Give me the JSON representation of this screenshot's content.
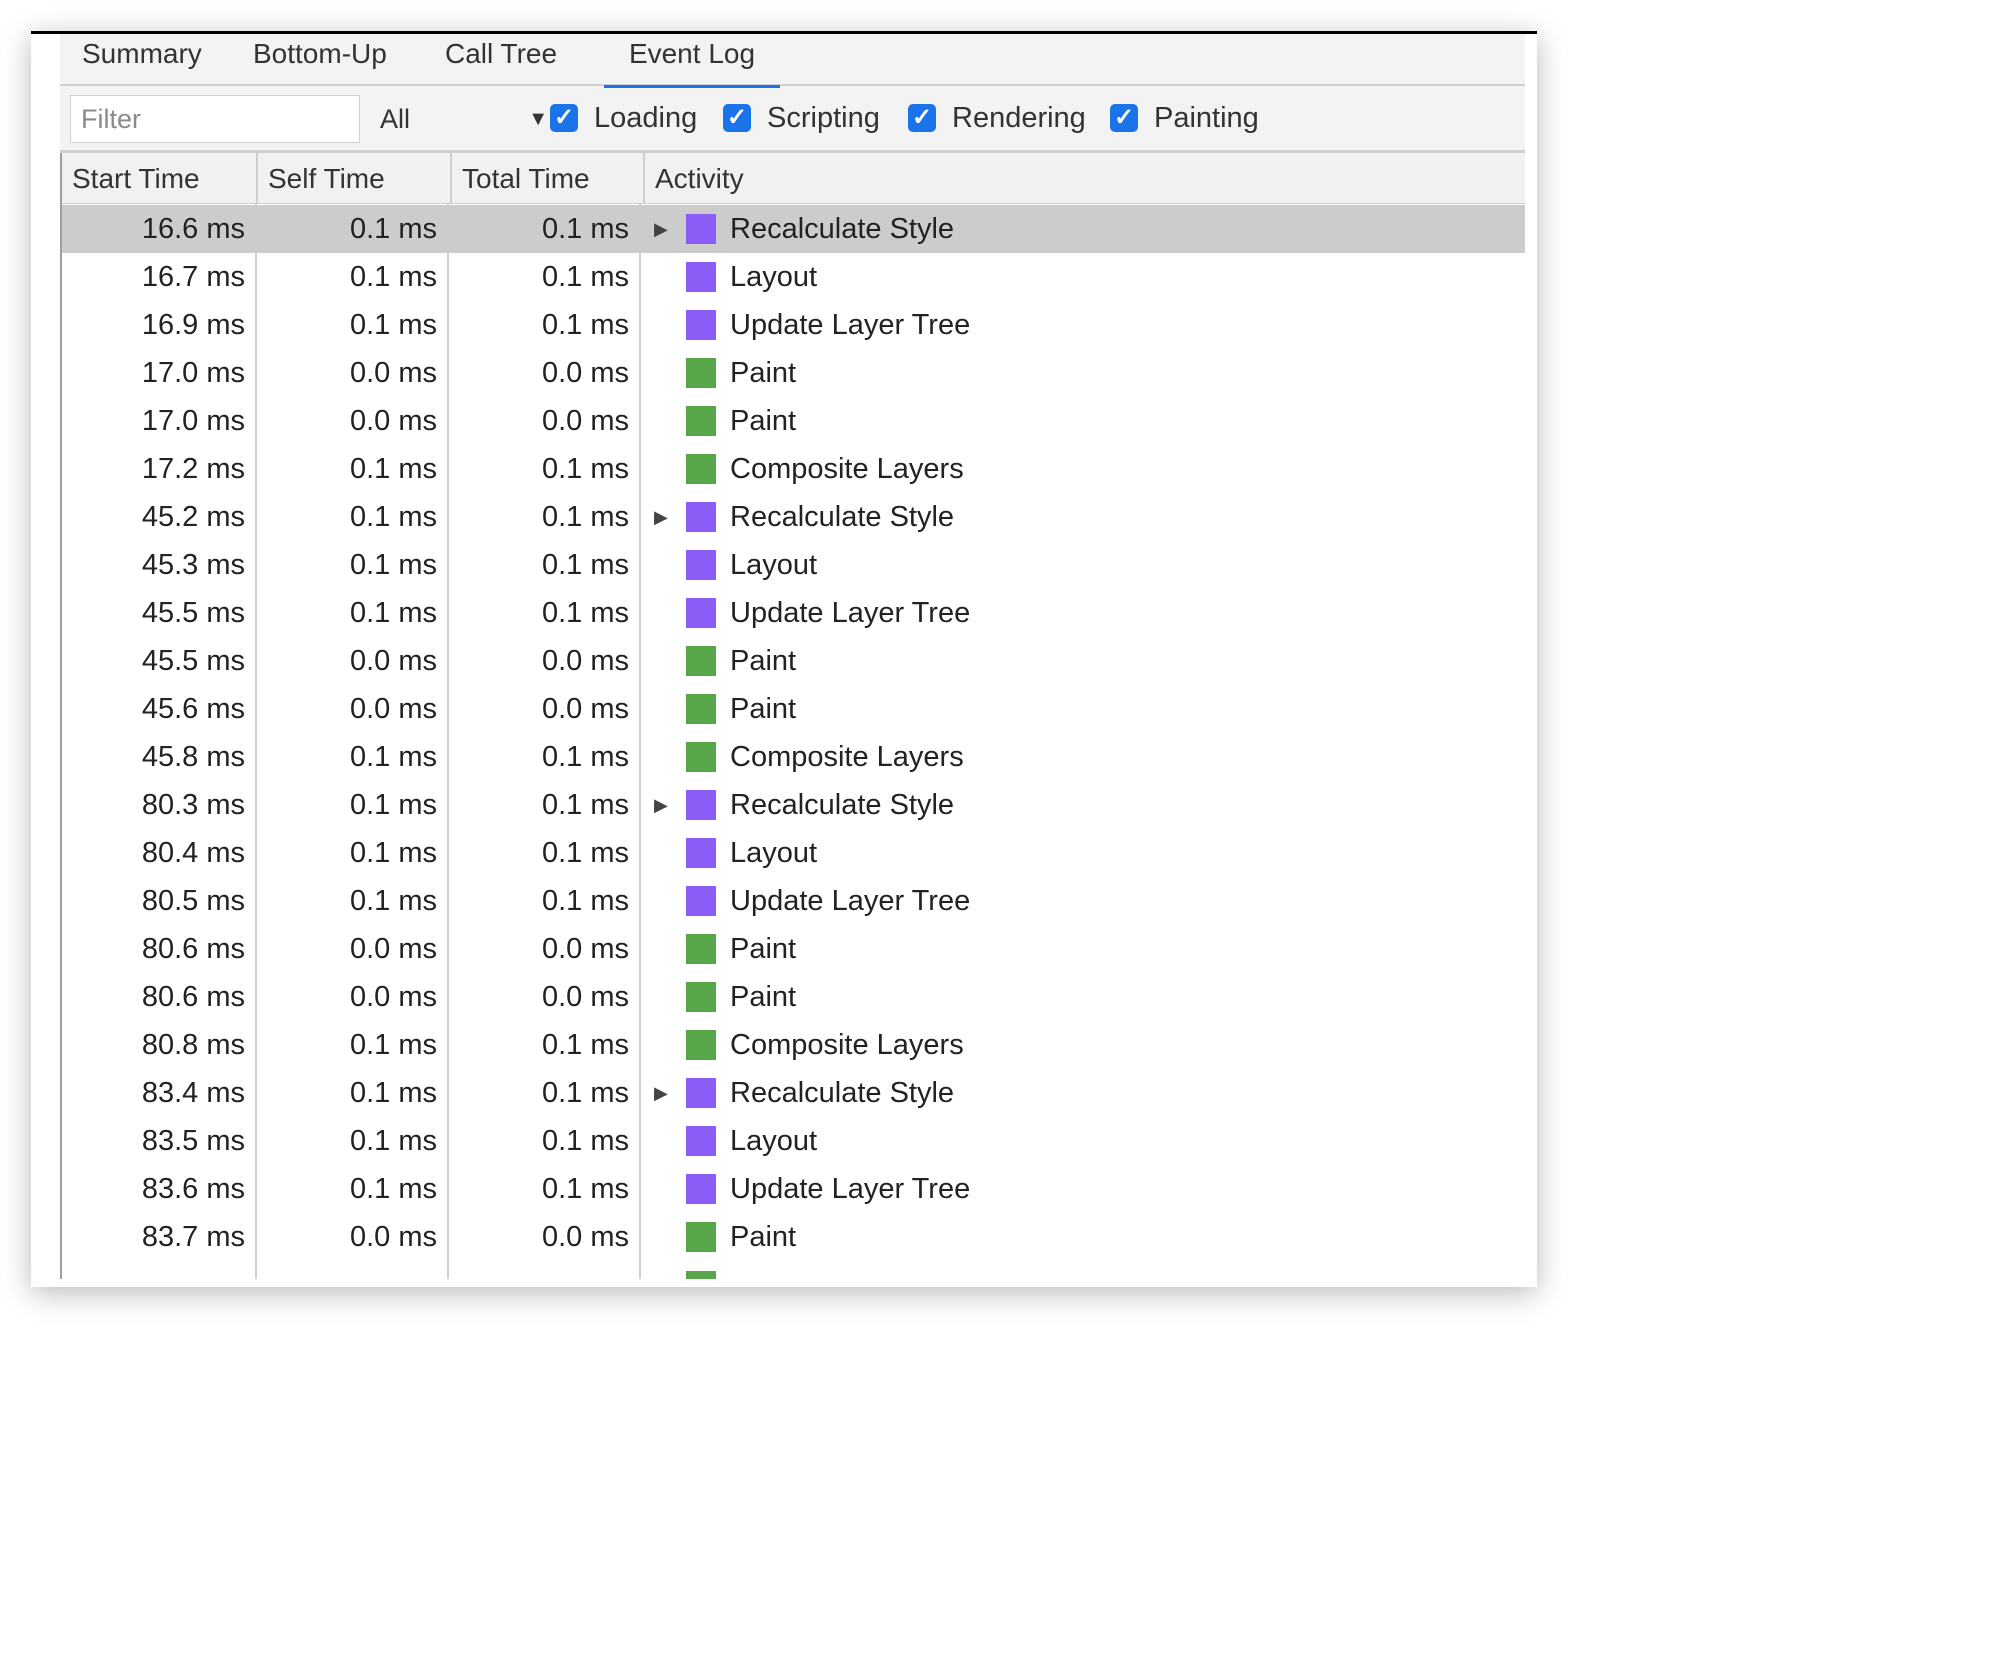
{
  "tabs": [
    "Summary",
    "Bottom-Up",
    "Call Tree",
    "Event Log"
  ],
  "active_tab": "Event Log",
  "toolbar": {
    "filter_placeholder": "Filter",
    "filter_value": "",
    "select_value": "All",
    "checkboxes": [
      {
        "label": "Loading",
        "checked": true
      },
      {
        "label": "Scripting",
        "checked": true
      },
      {
        "label": "Rendering",
        "checked": true
      },
      {
        "label": "Painting",
        "checked": true
      }
    ]
  },
  "columns": [
    "Start Time",
    "Self Time",
    "Total Time",
    "Activity"
  ],
  "colors": {
    "accent": "#1a73e8",
    "rendering": "#8b5cf6",
    "painting": "#57a64a",
    "selected_row": "#cccccc"
  },
  "rows": [
    {
      "start": "16.6 ms",
      "self": "0.1 ms",
      "total": "0.1 ms",
      "activity": "Recalculate Style",
      "category": "rendering",
      "expandable": true,
      "selected": true
    },
    {
      "start": "16.7 ms",
      "self": "0.1 ms",
      "total": "0.1 ms",
      "activity": "Layout",
      "category": "rendering",
      "expandable": false
    },
    {
      "start": "16.9 ms",
      "self": "0.1 ms",
      "total": "0.1 ms",
      "activity": "Update Layer Tree",
      "category": "rendering",
      "expandable": false
    },
    {
      "start": "17.0 ms",
      "self": "0.0 ms",
      "total": "0.0 ms",
      "activity": "Paint",
      "category": "painting",
      "expandable": false
    },
    {
      "start": "17.0 ms",
      "self": "0.0 ms",
      "total": "0.0 ms",
      "activity": "Paint",
      "category": "painting",
      "expandable": false
    },
    {
      "start": "17.2 ms",
      "self": "0.1 ms",
      "total": "0.1 ms",
      "activity": "Composite Layers",
      "category": "painting",
      "expandable": false
    },
    {
      "start": "45.2 ms",
      "self": "0.1 ms",
      "total": "0.1 ms",
      "activity": "Recalculate Style",
      "category": "rendering",
      "expandable": true
    },
    {
      "start": "45.3 ms",
      "self": "0.1 ms",
      "total": "0.1 ms",
      "activity": "Layout",
      "category": "rendering",
      "expandable": false
    },
    {
      "start": "45.5 ms",
      "self": "0.1 ms",
      "total": "0.1 ms",
      "activity": "Update Layer Tree",
      "category": "rendering",
      "expandable": false
    },
    {
      "start": "45.5 ms",
      "self": "0.0 ms",
      "total": "0.0 ms",
      "activity": "Paint",
      "category": "painting",
      "expandable": false
    },
    {
      "start": "45.6 ms",
      "self": "0.0 ms",
      "total": "0.0 ms",
      "activity": "Paint",
      "category": "painting",
      "expandable": false
    },
    {
      "start": "45.8 ms",
      "self": "0.1 ms",
      "total": "0.1 ms",
      "activity": "Composite Layers",
      "category": "painting",
      "expandable": false
    },
    {
      "start": "80.3 ms",
      "self": "0.1 ms",
      "total": "0.1 ms",
      "activity": "Recalculate Style",
      "category": "rendering",
      "expandable": true
    },
    {
      "start": "80.4 ms",
      "self": "0.1 ms",
      "total": "0.1 ms",
      "activity": "Layout",
      "category": "rendering",
      "expandable": false
    },
    {
      "start": "80.5 ms",
      "self": "0.1 ms",
      "total": "0.1 ms",
      "activity": "Update Layer Tree",
      "category": "rendering",
      "expandable": false
    },
    {
      "start": "80.6 ms",
      "self": "0.0 ms",
      "total": "0.0 ms",
      "activity": "Paint",
      "category": "painting",
      "expandable": false
    },
    {
      "start": "80.6 ms",
      "self": "0.0 ms",
      "total": "0.0 ms",
      "activity": "Paint",
      "category": "painting",
      "expandable": false
    },
    {
      "start": "80.8 ms",
      "self": "0.1 ms",
      "total": "0.1 ms",
      "activity": "Composite Layers",
      "category": "painting",
      "expandable": false
    },
    {
      "start": "83.4 ms",
      "self": "0.1 ms",
      "total": "0.1 ms",
      "activity": "Recalculate Style",
      "category": "rendering",
      "expandable": true
    },
    {
      "start": "83.5 ms",
      "self": "0.1 ms",
      "total": "0.1 ms",
      "activity": "Layout",
      "category": "rendering",
      "expandable": false
    },
    {
      "start": "83.6 ms",
      "self": "0.1 ms",
      "total": "0.1 ms",
      "activity": "Update Layer Tree",
      "category": "rendering",
      "expandable": false
    },
    {
      "start": "83.7 ms",
      "self": "0.0 ms",
      "total": "0.0 ms",
      "activity": "Paint",
      "category": "painting",
      "expandable": false
    }
  ]
}
